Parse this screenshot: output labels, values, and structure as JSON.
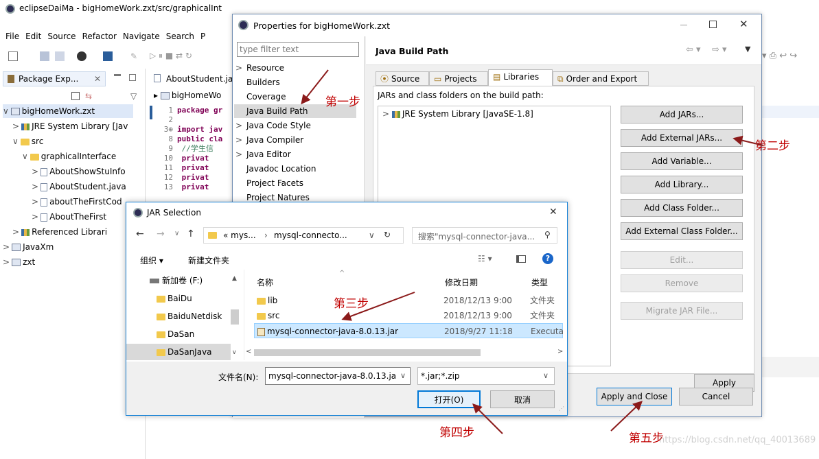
{
  "eclipse": {
    "title": "eclipseDaiMa - bigHomeWork.zxt/src/graphicalInt",
    "menu": [
      "File",
      "Edit",
      "Source",
      "Refactor",
      "Navigate",
      "Search",
      "P"
    ],
    "pkg_tab": "Package Exp...",
    "pkg_tab_close": "✕",
    "tree": [
      {
        "label": "bigHomeWork.zxt",
        "level": 0,
        "arrow": "∨",
        "icon": "proj",
        "sel": true
      },
      {
        "label": "JRE System Library [Jav",
        "level": 1,
        "arrow": ">",
        "icon": "lib"
      },
      {
        "label": "src",
        "level": 1,
        "arrow": "∨",
        "icon": "folder"
      },
      {
        "label": "graphicalInterface",
        "level": 2,
        "arrow": "∨",
        "icon": "folder"
      },
      {
        "label": "AboutShowStuInfo",
        "level": 3,
        "arrow": ">",
        "icon": "jfile"
      },
      {
        "label": "AboutStudent.java",
        "level": 3,
        "arrow": ">",
        "icon": "jfile"
      },
      {
        "label": "aboutTheFirstCod",
        "level": 3,
        "arrow": ">",
        "icon": "jfile"
      },
      {
        "label": "AboutTheFirst",
        "level": 3,
        "arrow": ">",
        "icon": "jfile"
      },
      {
        "label": "Referenced Librari",
        "level": 1,
        "arrow": ">",
        "icon": "lib"
      },
      {
        "label": "JavaXm",
        "level": 0,
        "arrow": ">",
        "icon": "proj"
      },
      {
        "label": "zxt",
        "level": 0,
        "arrow": ">",
        "icon": "proj"
      }
    ],
    "editor_tab": "AboutStudent.ja",
    "editor_crumb": "bigHomeWo",
    "code": [
      {
        "n": "1",
        "t": "package gr",
        "kw": true
      },
      {
        "n": "2",
        "t": ""
      },
      {
        "n": "3⊕",
        "t": "import jav",
        "kw": true
      },
      {
        "n": "8",
        "t": "public cla",
        "kw": true
      },
      {
        "n": "9",
        "t": "    //学生信",
        "comment": true
      },
      {
        "n": "10",
        "t": "    privat",
        "kw": true
      },
      {
        "n": "11",
        "t": "    privat",
        "kw": true
      },
      {
        "n": "12",
        "t": "    privat",
        "kw": true
      },
      {
        "n": "13",
        "t": "    privat",
        "kw": true
      }
    ]
  },
  "props": {
    "title": "Properties for bigHomeWork.zxt",
    "filter_placeholder": "type filter text",
    "nav": [
      {
        "label": "Resource",
        "arrow": ">"
      },
      {
        "label": "Builders",
        "arrow": ""
      },
      {
        "label": "Coverage",
        "arrow": ""
      },
      {
        "label": "Java Build Path",
        "arrow": "",
        "sel": true
      },
      {
        "label": "Java Code Style",
        "arrow": ">"
      },
      {
        "label": "Java Compiler",
        "arrow": ">"
      },
      {
        "label": "Java Editor",
        "arrow": ">"
      },
      {
        "label": "Javadoc Location",
        "arrow": ""
      },
      {
        "label": "Project Facets",
        "arrow": ""
      },
      {
        "label": "Project Natures",
        "arrow": ""
      }
    ],
    "heading": "Java Build Path",
    "tabs": [
      "Source",
      "Projects",
      "Libraries",
      "Order and Export"
    ],
    "active_tab": "Libraries",
    "jars_label": "JARs and class folders on the build path:",
    "lib_entry": "JRE System Library [JavaSE-1.8]",
    "buttons": [
      {
        "label": "Add JARs...",
        "enabled": true
      },
      {
        "label": "Add External JARs...",
        "enabled": true
      },
      {
        "label": "Add Variable...",
        "enabled": true
      },
      {
        "label": "Add Library...",
        "enabled": true
      },
      {
        "label": "Add Class Folder...",
        "enabled": true
      },
      {
        "label": "Add External Class Folder...",
        "enabled": true
      },
      {
        "label": "Edit...",
        "enabled": false
      },
      {
        "label": "Remove",
        "enabled": false
      },
      {
        "label": "Migrate JAR File...",
        "enabled": false
      }
    ],
    "apply": "Apply",
    "apply_close": "Apply and Close",
    "cancel": "Cancel"
  },
  "jar": {
    "title": "JAR Selection",
    "path": [
      "« mys...",
      "mysql-connecto..."
    ],
    "search_placeholder": "搜索\"mysql-connector-java...",
    "organize": "组织 ▾",
    "new_folder": "新建文件夹",
    "side": [
      {
        "label": "新加卷 (F:)",
        "drive": true
      },
      {
        "label": "BaiDu"
      },
      {
        "label": "BaiduNetdisk"
      },
      {
        "label": "DaSan"
      },
      {
        "label": "DaSanJava",
        "sel": true
      }
    ],
    "cols": [
      "名称",
      "修改日期",
      "类型"
    ],
    "files": [
      {
        "name": "lib",
        "date": "2018/12/13 9:00",
        "type": "文件夹",
        "icon": "folder"
      },
      {
        "name": "src",
        "date": "2018/12/13 9:00",
        "type": "文件夹",
        "icon": "folder"
      },
      {
        "name": "mysql-connector-java-8.0.13.jar",
        "date": "2018/9/27 11:18",
        "type": "Executab",
        "icon": "jar",
        "sel": true
      }
    ],
    "filename_label": "文件名(N):",
    "filename_value": "mysql-connector-java-8.0.13.ja",
    "filter_value": "*.jar;*.zip",
    "open": "打开(O)",
    "cancel": "取消"
  },
  "steps": [
    "第一步",
    "第二步",
    "第三步",
    "第四步",
    "第五步"
  ],
  "watermark": "https://blog.csdn.net/qq_40013689",
  "colors": {
    "accent": "#0078d7",
    "selection": "#cce8ff",
    "annotation": "#c00000",
    "arrow": "#8b1a1a"
  }
}
